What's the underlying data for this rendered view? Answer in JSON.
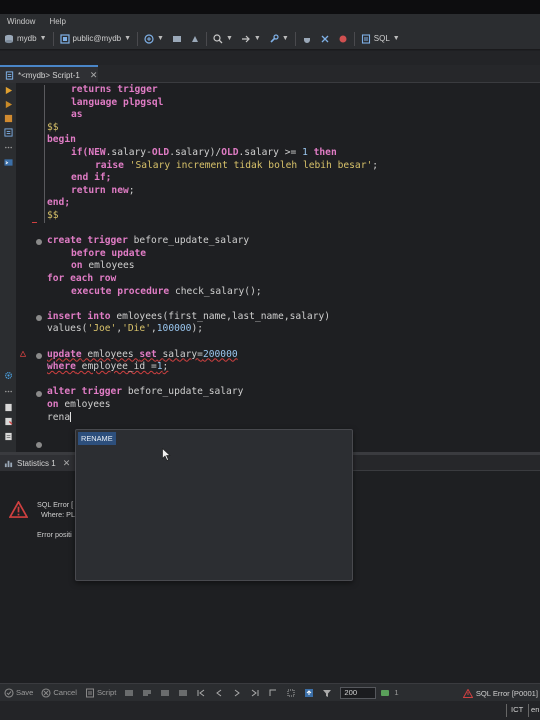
{
  "menu": {
    "items": [
      "Window",
      "Help"
    ]
  },
  "toolbar": {
    "datasource": "mydb",
    "schema": "public@mydb",
    "sql_label": "SQL"
  },
  "editor_tab": {
    "label": "*<mydb> Script-1",
    "close": "✕"
  },
  "code": {
    "l1": [
      "returns trigger"
    ],
    "l2": [
      "language plpgsql"
    ],
    "l3": [
      "as"
    ],
    "l4": "$$",
    "l5": "begin",
    "l6": {
      "if": "if(",
      "new": "NEW",
      "a": ".salary-",
      "old": "OLD",
      "b": ".salary)/",
      "old2": "OLD",
      "c": ".salary >= ",
      "one": "1",
      "then": " then"
    },
    "l7": {
      "raise": "raise",
      "s": "'Salary increment tidak boleh lebih besar'",
      "e": ";"
    },
    "l8": "end if;",
    "l9": {
      "ret": "return new",
      "e": ";"
    },
    "l10": "end;",
    "l11": "$$",
    "l12": {
      "k": "create trigger",
      "t": " before_update_salary"
    },
    "l13": {
      "k": "before update"
    },
    "l14": {
      "k": "on",
      "t": " emloyees"
    },
    "l15": {
      "k": "for each row"
    },
    "l16": {
      "k": "execute procedure",
      "t": " check_salary();"
    },
    "l17": {
      "k": "insert into",
      "t": " emloyees(first_name,last_name,salary)"
    },
    "l18": {
      "t": "values(",
      "s1": "'Joe'",
      "c1": ",",
      "s2": "'Die'",
      "c2": ",",
      "n": "100000",
      "e": ");"
    },
    "l19": {
      "k": "update",
      "t1": " emloyees ",
      "k2": "set",
      "t2": " salary=",
      "n": "200000"
    },
    "l20": {
      "k": "where",
      "t": " employee_id =",
      "n": "1",
      "e": ";"
    },
    "l21": {
      "k": "alter trigger",
      "t": " before_update_salary"
    },
    "l22": {
      "k": "on",
      "t": " emloyees"
    },
    "l23": {
      "t": "rena"
    }
  },
  "autocomplete": {
    "items": [
      "RENAME"
    ]
  },
  "results_tab": {
    "label": "Statistics 1",
    "close": "✕"
  },
  "error": {
    "title": "SQL Error [",
    "where": "Where: PL",
    "position": "Error positi"
  },
  "statusbar": {
    "save": "Save",
    "cancel": "Cancel",
    "script": "Script",
    "fetch_size": "200",
    "page": "1",
    "error": "SQL Error [P0001]"
  },
  "bottombar": {
    "tz": "ICT",
    "lang": "en"
  },
  "colors": {
    "accent": "#4a86c8",
    "keyword": "#e07cc5",
    "string": "#d8c26a",
    "error": "#d04040"
  }
}
